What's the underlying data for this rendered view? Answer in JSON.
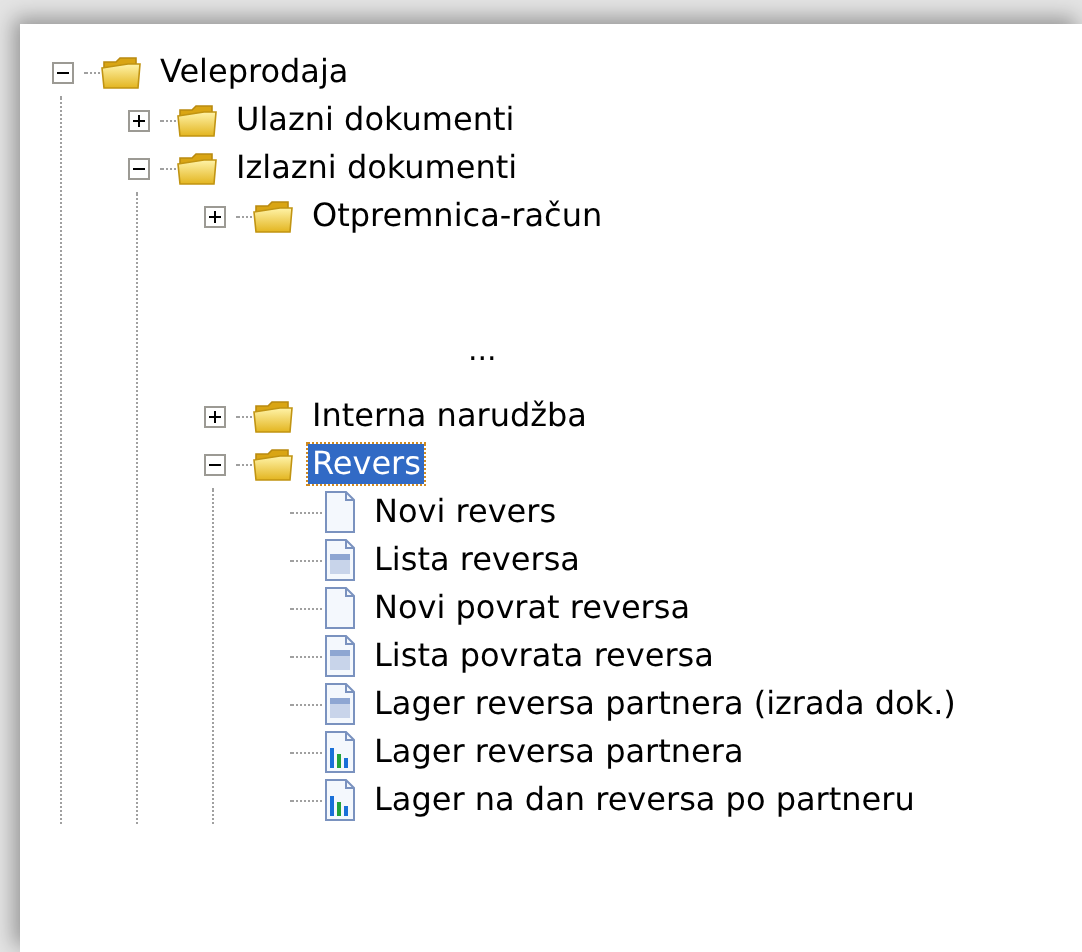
{
  "tree": [
    {
      "kind": "folder",
      "label": "Veleprodaja",
      "expanded": true,
      "selected": false,
      "children": [
        {
          "kind": "folder",
          "label": "Ulazni dokumenti",
          "expanded": false,
          "selected": false
        },
        {
          "kind": "folder",
          "label": "Izlazni dokumenti",
          "expanded": true,
          "selected": false,
          "children": [
            {
              "kind": "folder",
              "label": "Otpremnica-račun",
              "expanded": false,
              "selected": false
            },
            {
              "kind": "ellipsis",
              "label": "..."
            },
            {
              "kind": "folder",
              "label": "Interna narudžba",
              "expanded": false,
              "selected": false
            },
            {
              "kind": "folder",
              "label": "Revers",
              "expanded": true,
              "selected": true,
              "children": [
                {
                  "kind": "document",
                  "label": "Novi revers",
                  "selected": false
                },
                {
                  "kind": "list",
                  "label": "Lista reversa",
                  "selected": false
                },
                {
                  "kind": "document",
                  "label": "Novi povrat reversa",
                  "selected": false
                },
                {
                  "kind": "list",
                  "label": "Lista povrata reversa",
                  "selected": false
                },
                {
                  "kind": "list",
                  "label": "Lager reversa partnera (izrada dok.)",
                  "selected": false
                },
                {
                  "kind": "report",
                  "label": "Lager reversa partnera",
                  "selected": false
                },
                {
                  "kind": "report",
                  "label": "Lager na dan reversa po partneru",
                  "selected": false
                }
              ]
            }
          ]
        }
      ]
    }
  ]
}
